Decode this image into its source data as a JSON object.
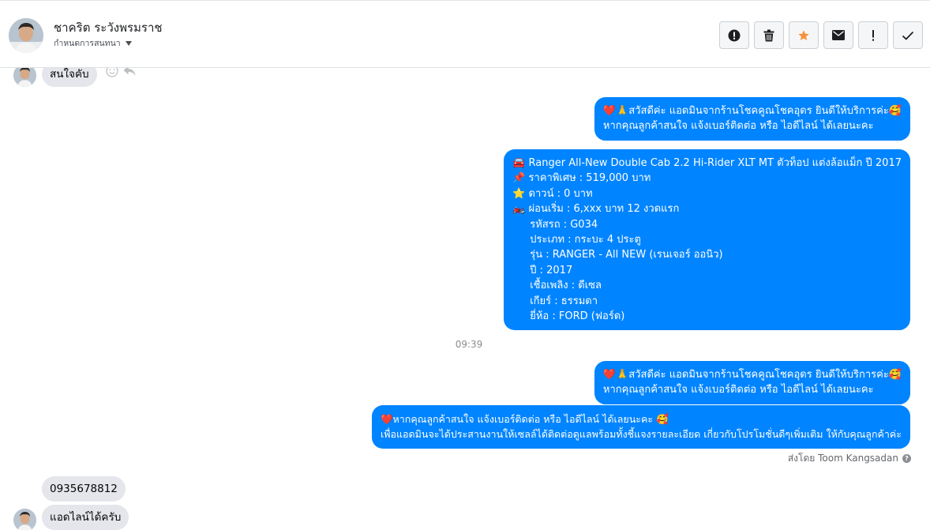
{
  "header": {
    "contact_name": "ชาคริต ระวังพรมราช",
    "manage_label": "กำหนดการสนทนา",
    "tools": [
      "report-icon",
      "trash-icon",
      "star-icon",
      "mail-icon",
      "priority-icon",
      "done-icon"
    ],
    "star_color": "#f7923a"
  },
  "messages": {
    "incoming_1": "สนใจคับ",
    "greeting_1": {
      "line1": "❤️🙏สวัสดีค่ะ แอดมินจากร้านโชคคูณโชคอุดร ยินดีให้บริการค่ะ🥰",
      "line2": "หากคุณลูกค้าสนใจ แจ้งเบอร์ติดต่อ หรือ ไอดีไลน์ ได้เลยนะคะ"
    },
    "car_listing": {
      "title": "🚘 Ranger All-New Double Cab 2.2 Hi-Rider XLT MT ตัวท็อป แต่งล้อแม็ก ปี 2017",
      "price": "📌 ราคาพิเศษ : 519,000 บาท",
      "down": "⭐ ดาวน์ : 0 บาท",
      "installment": "🏍️ ผ่อนเริ่ม : 6,xxx บาท 12 งวดแรก",
      "code": "รหัสรถ : G034",
      "type": "ประเภท : กระบะ 4 ประตู",
      "model": "รุ่น : RANGER - All NEW (เรนเจอร์ ออนิว)",
      "year": "ปี : 2017",
      "fuel": "เชื้อเพลิง : ดีเซล",
      "gear": "เกียร์ : ธรรมดา",
      "brand": "ยี่ห้อ : FORD (ฟอร์ด)"
    },
    "timestamp": "09:39",
    "greeting_2": {
      "line1": "❤️🙏สวัสดีค่ะ แอดมินจากร้านโชคคูณโชคอุดร ยินดีให้บริการค่ะ🥰",
      "line2": "หากคุณลูกค้าสนใจ แจ้งเบอร์ติดต่อ หรือ ไอดีไลน์ ได้เลยนะคะ"
    },
    "followup": {
      "line1": "❤️หากคุณลูกค้าสนใจ แจ้งเบอร์ติดต่อ หรือ ไอดีไลน์ ได้เลยนะคะ 🥰",
      "line2": "เพื่อแอดมินจะได้ประสานงานให้เซลล์ได้ติดต่อดูแลพร้อมทั้งชี้แจงรายละเอียด เกี่ยวกับโปรโมชั่นดีๆเพิ่มเติม ให้กับคุณลูกค้าค่ะ"
    },
    "sent_by": "ส่งโดย Toom Kangsadan",
    "phone": "0935678812",
    "incoming_last": "แอดไลน์ได้ครับ"
  },
  "colors": {
    "outgoing_bubble": "#0084ff",
    "incoming_bubble": "#e4e6eb"
  }
}
